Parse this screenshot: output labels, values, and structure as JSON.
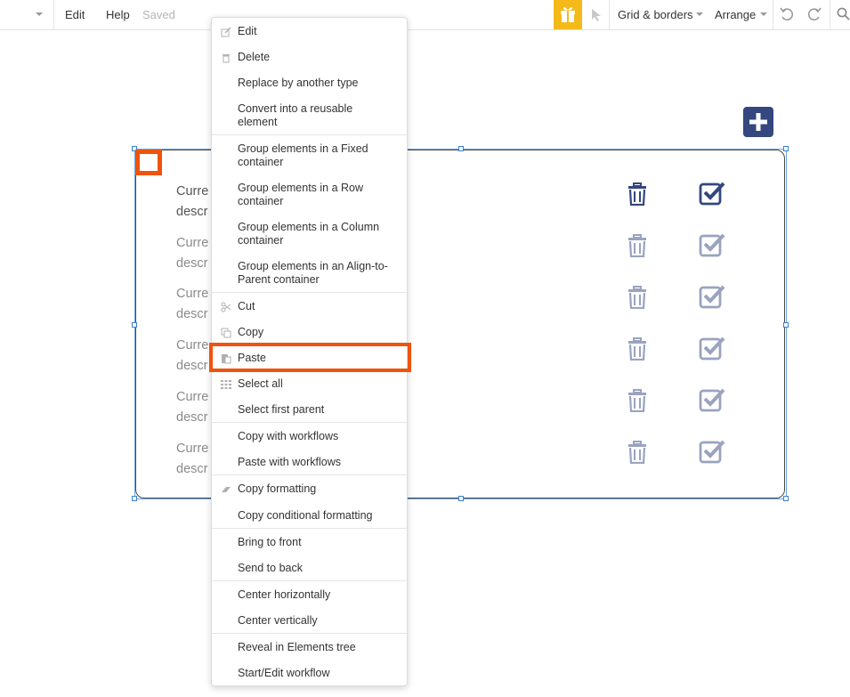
{
  "topbar": {
    "edit_label": "Edit",
    "help_label": "Help",
    "saved_label": "Saved",
    "grid_label": "Grid & borders",
    "arrange_label": "Arrange"
  },
  "rows": [
    {
      "line1": "Curre",
      "line2": "descr"
    },
    {
      "line1": "Curre",
      "line2": "descr"
    },
    {
      "line1": "Curre",
      "line2": "descr"
    },
    {
      "line1": "Curre",
      "line2": "descr"
    },
    {
      "line1": "Curre",
      "line2": "descr"
    },
    {
      "line1": "Curre",
      "line2": "descr"
    }
  ],
  "menu": {
    "edit": "Edit",
    "delete": "Delete",
    "replace": "Replace by another type",
    "convert_1": "Convert into a reusable",
    "convert_2": "element",
    "group_fixed_1": "Group elements in a Fixed",
    "group_fixed_2": "container",
    "group_row_1": "Group elements in a Row",
    "group_row_2": "container",
    "group_col_1": "Group elements in a Column",
    "group_col_2": "container",
    "group_align_1": "Group elements in an Align-to-",
    "group_align_2": "Parent container",
    "cut": "Cut",
    "copy": "Copy",
    "paste": "Paste",
    "select_all": "Select all",
    "select_parent": "Select first parent",
    "copy_wf": "Copy with workflows",
    "paste_wf": "Paste with workflows",
    "copy_fmt": "Copy formatting",
    "copy_cond_fmt": "Copy conditional formatting",
    "bring_front": "Bring to front",
    "send_back": "Send to back",
    "center_h": "Center horizontally",
    "center_v": "Center vertically",
    "reveal": "Reveal in Elements tree",
    "start_wf": "Start/Edit workflow"
  },
  "colors": {
    "accent_orange": "#f0530d",
    "navy": "#34477f",
    "gift_yellow": "#f5b91a"
  }
}
